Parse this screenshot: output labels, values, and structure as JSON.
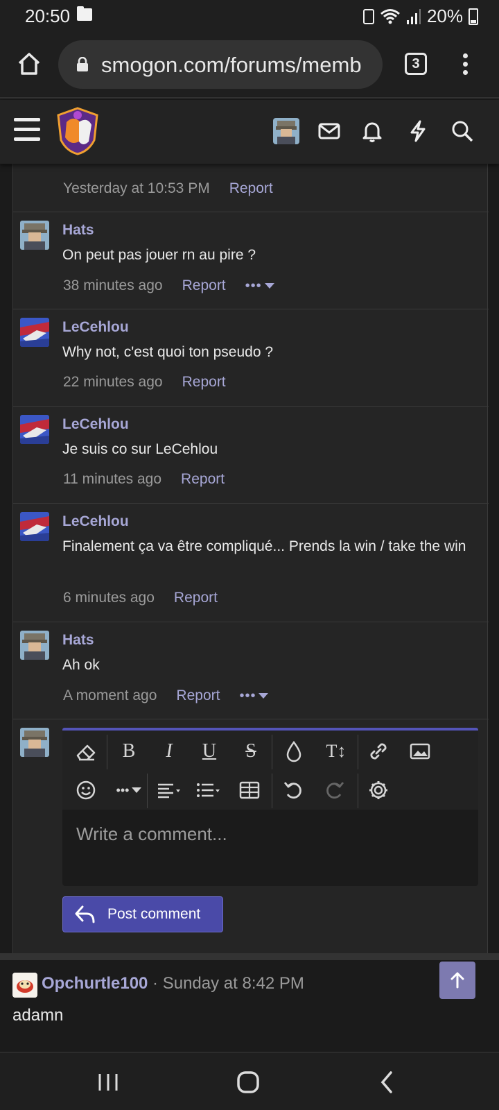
{
  "status_bar": {
    "time": "20:50",
    "battery_percent": "20%",
    "icons": [
      "folder-icon",
      "battery-saver-icon",
      "wifi-icon",
      "signal-icon",
      "battery-icon"
    ]
  },
  "browser": {
    "url": "smogon.com/forums/memb",
    "tab_count": "3"
  },
  "site_header": {
    "icons": [
      "hamburger-menu-icon",
      "smogon-logo",
      "user-avatar",
      "mail-icon",
      "bell-icon",
      "lightning-icon",
      "search-icon"
    ]
  },
  "comments": [
    {
      "user": "",
      "text": "",
      "time": "Yesterday at 10:53 PM",
      "report": "Report",
      "more": false
    },
    {
      "user": "Hats",
      "text": "On peut pas jouer rn au pire ?",
      "time": "38 minutes ago",
      "report": "Report",
      "more": true,
      "more_label": "•••"
    },
    {
      "user": "LeCehlou",
      "text": "Why not, c'est quoi ton pseudo ?",
      "time": "22 minutes ago",
      "report": "Report",
      "more": false
    },
    {
      "user": "LeCehlou",
      "text": "Je suis co sur LeCehlou",
      "time": "11 minutes ago",
      "report": "Report",
      "more": false
    },
    {
      "user": "LeCehlou",
      "text": "Finalement ça va être compliqué... Prends la win / take the win",
      "time": "6 minutes ago",
      "report": "Report",
      "more": false
    },
    {
      "user": "Hats",
      "text": "Ah ok",
      "time": "A moment ago",
      "report": "Report",
      "more": true,
      "more_label": "•••"
    }
  ],
  "editor": {
    "placeholder": "Write a comment...",
    "post_label": "Post comment",
    "toolbar_row1": [
      "eraser-icon",
      "bold-icon",
      "italic-icon",
      "underline-icon",
      "strikethrough-icon",
      "color-drop-icon",
      "font-size-icon",
      "link-icon",
      "image-icon"
    ],
    "toolbar_row2": [
      "emoji-icon",
      "more-options-icon",
      "align-icon",
      "list-icon",
      "table-icon",
      "undo-icon",
      "redo-icon",
      "settings-icon"
    ],
    "bold": "B",
    "italic": "I",
    "underline": "U",
    "strike": "S",
    "font_size": "T↕",
    "more": "•••"
  },
  "profile_post": {
    "user": "Opchurtle100",
    "separator": " · ",
    "time": "Sunday at 8:42 PM",
    "text": "adamn"
  },
  "nav": [
    "recent-apps-icon",
    "home-icon",
    "back-icon"
  ],
  "colors": {
    "accent": "#a7a7d6",
    "button": "#4a4aa8",
    "editor_border": "#5454b8"
  }
}
